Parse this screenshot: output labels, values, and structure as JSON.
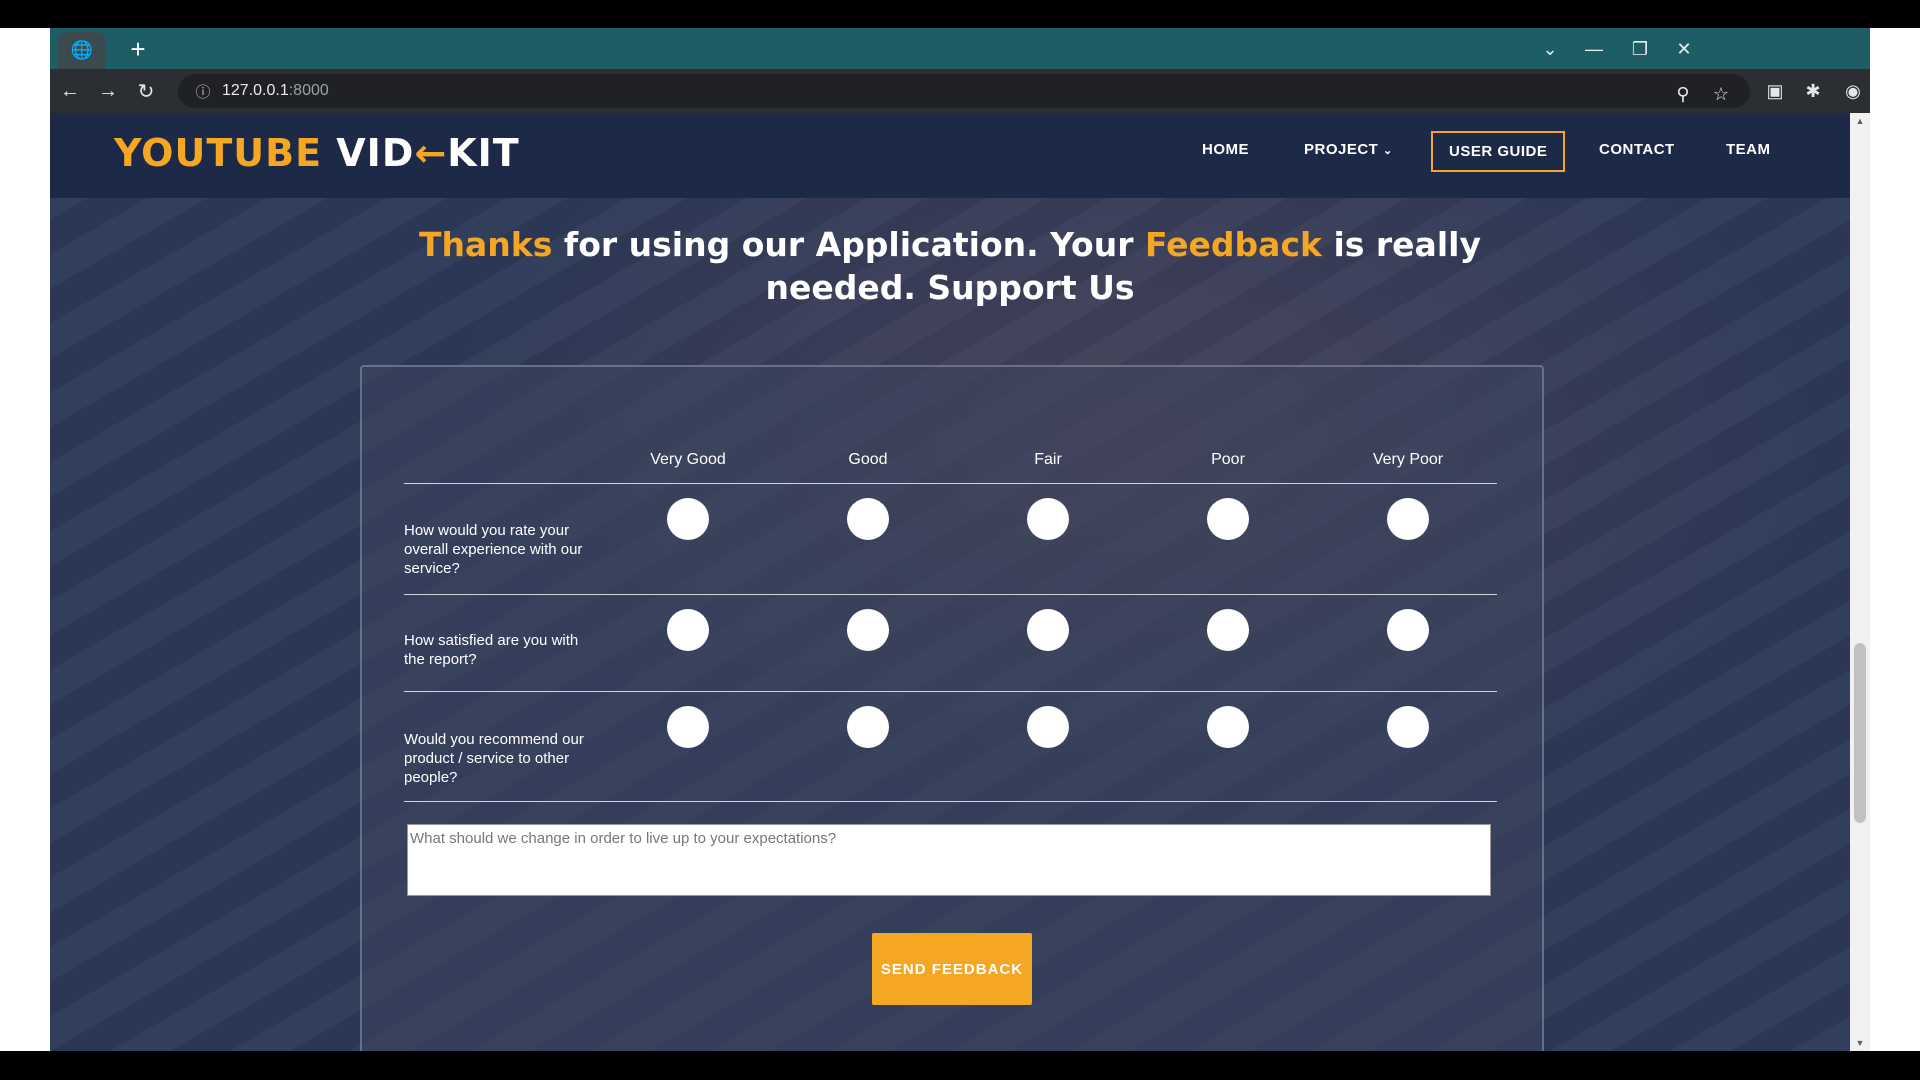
{
  "browser": {
    "new_tab": "+",
    "url_host": "127.0.0.1",
    "url_port": ":8000"
  },
  "site": {
    "logo_part1": "YOUTUBE",
    "logo_part2": "VID",
    "logo_arrow": "←",
    "logo_part3": "KIT",
    "nav": {
      "home": "HOME",
      "project": "PROJECT",
      "user_guide": "USER GUIDE",
      "contact": "CONTACT",
      "team": "TEAM"
    }
  },
  "heading": {
    "w1": "Thanks",
    "t1": " for using our Application. Your ",
    "w2": "Feedback",
    "t2": " is really needed. Support Us"
  },
  "form": {
    "columns": [
      "Very Good",
      "Good",
      "Fair",
      "Poor",
      "Very Poor"
    ],
    "questions": [
      "How would you rate your overall experience with our service?",
      "How satisfied are you with the report?",
      "Would you recommend our product / service to other people?"
    ],
    "textarea_placeholder": "What should we change in order to live up to your expectations?",
    "send_label": "SEND FEEDBACK"
  },
  "colors": {
    "accent": "#f5a623",
    "navbar": "#1c2a48",
    "tabstrip": "#1e5c66"
  }
}
